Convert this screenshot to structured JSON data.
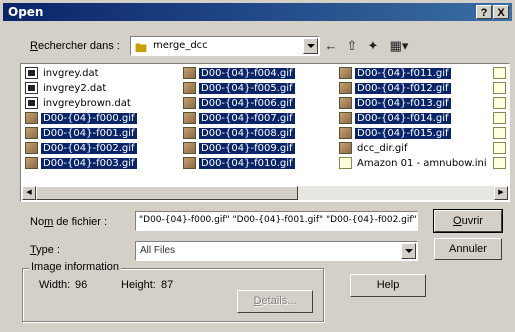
{
  "window": {
    "title": "Open",
    "help_btn": "?",
    "close_btn": "X"
  },
  "location": {
    "label_prefix": "R",
    "label_rest": "echercher dans :",
    "folder": "merge_dcc"
  },
  "columns": [
    [
      {
        "name": "invgrey.dat",
        "type": "dat",
        "selected": false
      },
      {
        "name": "invgrey2.dat",
        "type": "dat",
        "selected": false
      },
      {
        "name": "invgreybrown.dat",
        "type": "dat",
        "selected": false
      },
      {
        "name": "D00-{04}-f000.gif",
        "type": "gif",
        "selected": true
      },
      {
        "name": "D00-{04}-f001.gif",
        "type": "gif",
        "selected": true
      },
      {
        "name": "D00-{04}-f002.gif",
        "type": "gif",
        "selected": true
      },
      {
        "name": "D00-{04}-f003.gif",
        "type": "gif",
        "selected": true
      }
    ],
    [
      {
        "name": "D00-{04}-f004.gif",
        "type": "gif",
        "selected": true
      },
      {
        "name": "D00-{04}-f005.gif",
        "type": "gif",
        "selected": true
      },
      {
        "name": "D00-{04}-f006.gif",
        "type": "gif",
        "selected": true
      },
      {
        "name": "D00-{04}-f007.gif",
        "type": "gif",
        "selected": true
      },
      {
        "name": "D00-{04}-f008.gif",
        "type": "gif",
        "selected": true
      },
      {
        "name": "D00-{04}-f009.gif",
        "type": "gif",
        "selected": true
      },
      {
        "name": "D00-{04}-f010.gif",
        "type": "gif",
        "selected": true
      }
    ],
    [
      {
        "name": "D00-{04}-f011.gif",
        "type": "gif",
        "selected": true
      },
      {
        "name": "D00-{04}-f012.gif",
        "type": "gif",
        "selected": true
      },
      {
        "name": "D00-{04}-f013.gif",
        "type": "gif",
        "selected": true
      },
      {
        "name": "D00-{04}-f014.gif",
        "type": "gif",
        "selected": true
      },
      {
        "name": "D00-{04}-f015.gif",
        "type": "gif",
        "selected": true
      },
      {
        "name": "dcc_dir.gif",
        "type": "gif",
        "selected": false
      },
      {
        "name": "Amazon 01 - amnubow.ini",
        "type": "ini",
        "selected": false
      }
    ]
  ],
  "filename": {
    "label_a": "No",
    "label_u": "m",
    "label_b": " de fichier :",
    "value": "\"D00-{04}-f000.gif\" \"D00-{04}-f001.gif\" \"D00-{04}-f002.gif\""
  },
  "filetype": {
    "label_u": "T",
    "label_rest": "ype :",
    "value": "All Files"
  },
  "buttons": {
    "open_u": "O",
    "open_rest": "uvrir",
    "cancel": "Annuler",
    "help": "Help",
    "details_u": "D",
    "details_rest": "etails..."
  },
  "image_info": {
    "title": "Image information",
    "width_label": "Width:",
    "width": "96",
    "height_label": "Height:",
    "height": "87"
  }
}
